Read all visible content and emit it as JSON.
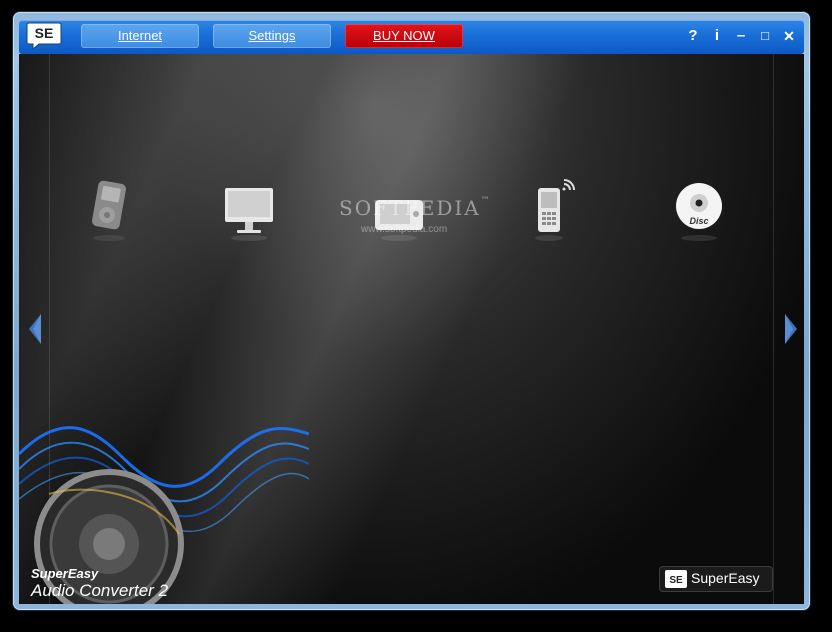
{
  "titlebar": {
    "logo_text": "SE",
    "nav": {
      "internet": "Internet",
      "settings": "Settings",
      "buy_now": "BUY NOW"
    },
    "controls": {
      "help": "?",
      "info": "i",
      "minimize": "–",
      "maximize": "□",
      "close": "✕"
    }
  },
  "devices": [
    {
      "icon": "ipod-icon"
    },
    {
      "icon": "computer-monitor-icon"
    },
    {
      "icon": "handheld-player-icon"
    },
    {
      "icon": "mobile-phone-icon"
    },
    {
      "icon": "disc-icon",
      "label": "Disc"
    }
  ],
  "watermark": {
    "text": "SOFTPEDIA",
    "trademark": "™",
    "url": "www.softpedia.com"
  },
  "branding": {
    "line1": "SuperEasy",
    "line2": "Audio Converter 2",
    "badge_logo": "SE",
    "badge_text": "SuperEasy"
  },
  "colors": {
    "titlebar": "#1a6ed8",
    "buy_button": "#d10a12",
    "arrow": "#3f73b8"
  }
}
